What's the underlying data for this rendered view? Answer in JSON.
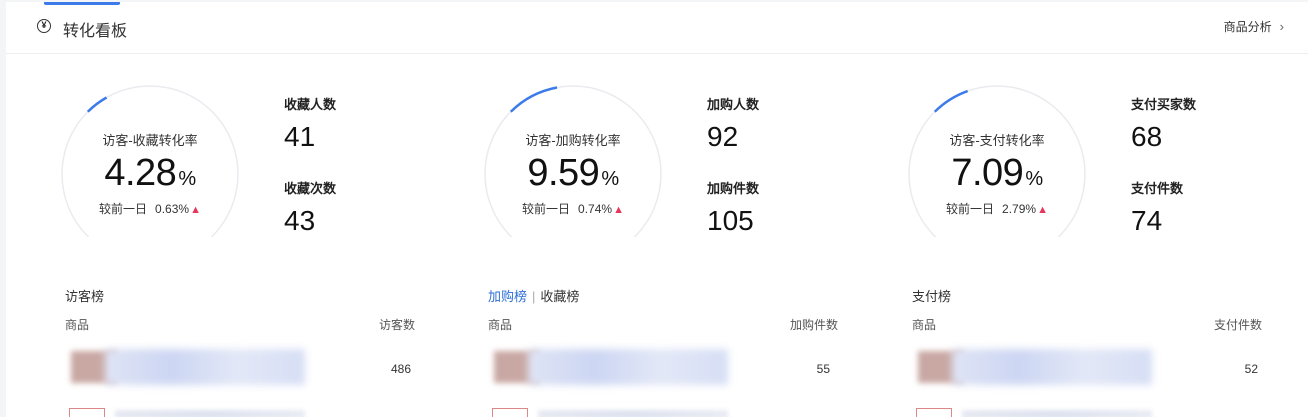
{
  "header": {
    "title": "转化看板",
    "link_label": "商品分析"
  },
  "colors": {
    "accent": "#3d7bea",
    "up": "#e8365a"
  },
  "funnels": [
    {
      "gauge_label": "访客-收藏转化率",
      "value": "4.28",
      "unit": "%",
      "compare_label": "较前一日",
      "compare_value": "0.63%",
      "rate": 0.0428,
      "stats": [
        {
          "label": "收藏人数",
          "value": "41"
        },
        {
          "label": "收藏次数",
          "value": "43"
        }
      ]
    },
    {
      "gauge_label": "访客-加购转化率",
      "value": "9.59",
      "unit": "%",
      "compare_label": "较前一日",
      "compare_value": "0.74%",
      "rate": 0.0959,
      "stats": [
        {
          "label": "加购人数",
          "value": "92"
        },
        {
          "label": "加购件数",
          "value": "105"
        }
      ]
    },
    {
      "gauge_label": "访客-支付转化率",
      "value": "7.09",
      "unit": "%",
      "compare_label": "较前一日",
      "compare_value": "2.79%",
      "rate": 0.0709,
      "stats": [
        {
          "label": "支付买家数",
          "value": "68"
        },
        {
          "label": "支付件数",
          "value": "74"
        }
      ]
    }
  ],
  "rankings": [
    {
      "title": "访客榜",
      "col_left": "商品",
      "col_right": "访客数",
      "first_value": "486"
    },
    {
      "tab_active": "加购榜",
      "tab_inactive": "收藏榜",
      "col_left": "商品",
      "col_right": "加购件数",
      "first_value": "55"
    },
    {
      "title": "支付榜",
      "col_left": "商品",
      "col_right": "支付件数",
      "first_value": "52"
    }
  ]
}
